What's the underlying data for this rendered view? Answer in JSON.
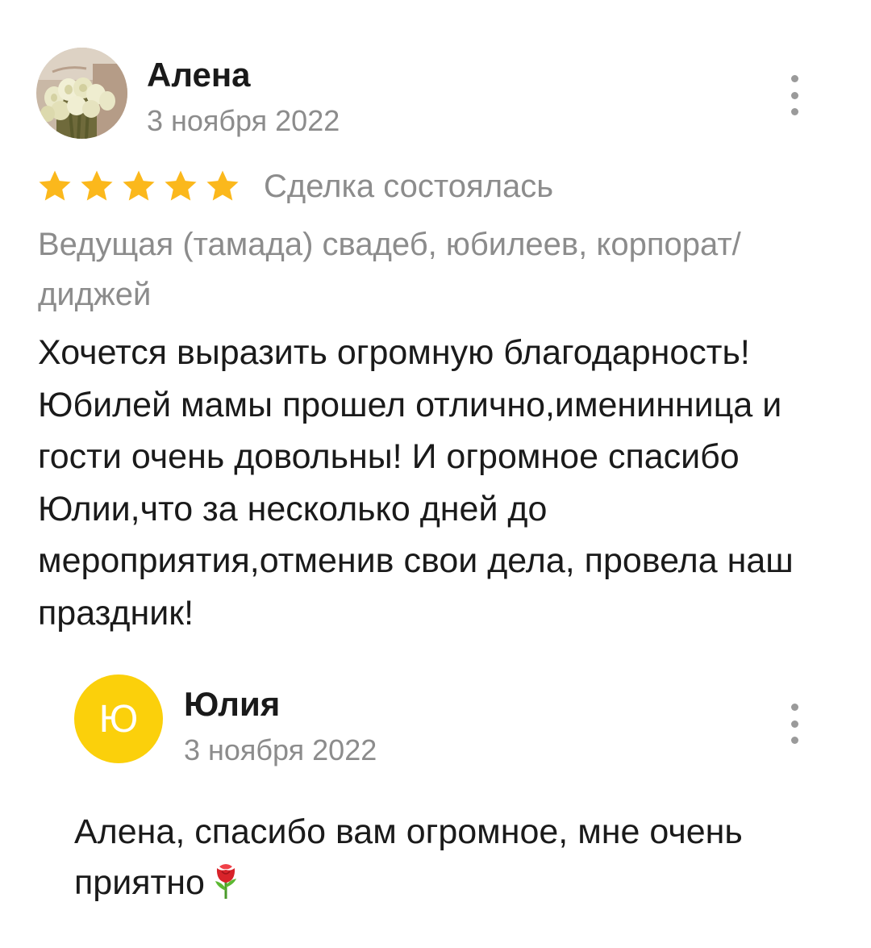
{
  "review": {
    "author": "Алена",
    "date": "3 ноября 2022",
    "rating": 5,
    "status": "Сделка состоялась",
    "service": "Ведущая (тамада) свадеб, юбилеев, корпорат/диджей",
    "text": "Хочется выразить огромную благодарность! Юбилей мамы прошел отлично,именинница и гости очень довольны! И огромное спасибо Юлии,что за несколько дней до мероприятия,отменив свои дела, провела наш праздник!",
    "avatar_icon": "bouquet-photo"
  },
  "reply": {
    "avatar_letter": "Ю",
    "avatar_color": "#fbd00b",
    "author": "Юлия",
    "date": "3 ноября 2022",
    "text": "Алена, спасибо вам огромное, мне очень приятно",
    "emoji_icon": "rose-icon"
  },
  "colors": {
    "star": "#fbb81c",
    "muted_text": "#8c8c8c",
    "main_text": "#1a1a1a"
  },
  "icons": {
    "menu": "more-vertical-icon",
    "star": "star-icon"
  }
}
